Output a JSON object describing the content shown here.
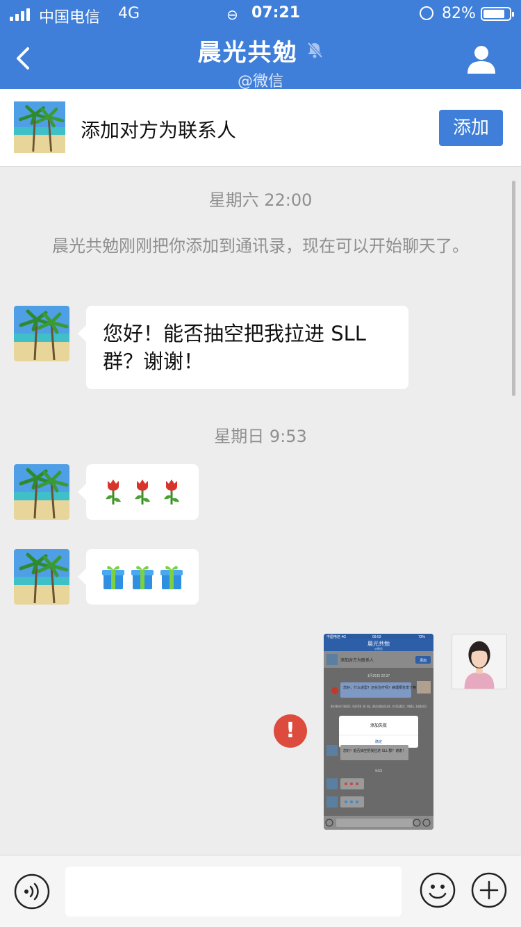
{
  "status_bar": {
    "carrier": "中国电信",
    "network": "4G",
    "time": "07:21",
    "battery_percent": "82%",
    "battery_level": 0.82
  },
  "navbar": {
    "title": "晨光共勉",
    "subtitle": "@微信",
    "accent_color": "#3f7fd9"
  },
  "add_banner": {
    "text": "添加对方为联系人",
    "button_label": "添加"
  },
  "chat": {
    "timestamp_1": "星期六 22:00",
    "system_message": "晨光共勉刚刚把你添加到通讯录，现在可以开始聊天了。",
    "message_1": "您好！能否抽空把我拉进 SLL 群？谢谢！",
    "timestamp_2": "星期日 9:53",
    "message_2_emojis": [
      "rose",
      "rose",
      "rose"
    ],
    "message_3_emojis": [
      "gift",
      "gift",
      "gift"
    ],
    "sent_image": {
      "send_status": "failed",
      "fail_icon": "!",
      "thumb": {
        "status_left": "中国电信 4G",
        "status_time": "09:53",
        "status_right": "73%",
        "title": "晨光共勉",
        "subtitle": "@微信",
        "add_text": "添加对方为联系人",
        "add_button": "添加",
        "timestamp": "1月26日 22:37",
        "reply_text": "您好，什么造型？还在治疗吗？病理报告发了嘛",
        "notice_text": "晨光共勉开启了朋友验证，你还不是他（她）朋友。请先发送朋友验证请求，对方验证通过后，才能聊天。发送朋友验证",
        "dialog_title": "添加失败",
        "dialog_button": "确定",
        "message_text": "您好！能否抽空把我拉进 SLL 群？谢谢！",
        "timestamp_2": "9:53"
      }
    }
  },
  "input_bar": {
    "placeholder": ""
  }
}
